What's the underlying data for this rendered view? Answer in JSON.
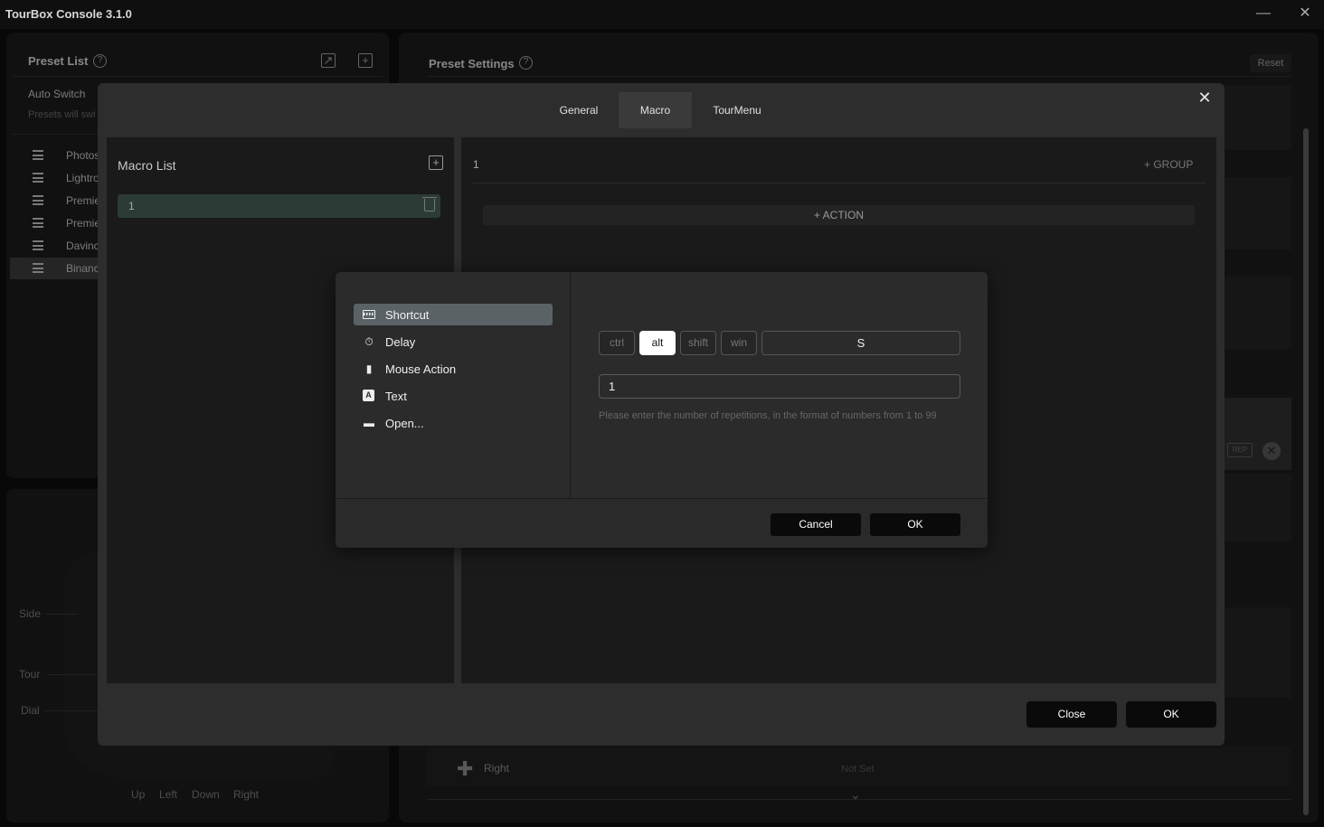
{
  "app": {
    "title": "TourBox Console 3.1.0"
  },
  "preset_list": {
    "title": "Preset List",
    "auto_switch": "Auto Switch",
    "auto_switch_desc": "Presets will swi",
    "items": [
      "Photos",
      "Lightro",
      "Premie",
      "Premie",
      "Davinc",
      "Binanc"
    ]
  },
  "device": {
    "labels": {
      "side": "Side",
      "tour": "Tour",
      "dial": "Dial",
      "up": "Up",
      "left": "Left",
      "down": "Down",
      "right": "Right"
    }
  },
  "preset_settings": {
    "title": "Preset Settings",
    "reset": "Reset",
    "rep_badge": "REP",
    "bottom_row_label": "Right",
    "bottom_row_value": "Not Set"
  },
  "macro_dialog": {
    "tabs": [
      "General",
      "Macro",
      "TourMenu"
    ],
    "active_tab": "Macro",
    "macro_list_title": "Macro List",
    "macros": [
      "1"
    ],
    "edit_name": "1",
    "group_label": "+ GROUP",
    "action_label": "+ ACTION",
    "close_label": "Close",
    "ok_label": "OK"
  },
  "action_dialog": {
    "types": [
      {
        "label": "Shortcut",
        "icon": "keyboard-icon"
      },
      {
        "label": "Delay",
        "icon": "stopwatch-icon"
      },
      {
        "label": "Mouse Action",
        "icon": "mouse-icon"
      },
      {
        "label": "Text",
        "icon": "text-icon"
      },
      {
        "label": "Open...",
        "icon": "folder-icon"
      }
    ],
    "selected": "Shortcut",
    "modifiers": [
      {
        "label": "ctrl",
        "on": false
      },
      {
        "label": "alt",
        "on": true
      },
      {
        "label": "shift",
        "on": false
      },
      {
        "label": "win",
        "on": false
      }
    ],
    "key": "S",
    "repetitions": "1",
    "hint": "Please enter the number of repetitions, in the format of numbers from 1 to 99",
    "cancel_label": "Cancel",
    "ok_label": "OK"
  },
  "colors": {
    "accent_selected": "#5a6266",
    "macro_item_bg": "#2c3b36",
    "button_bg": "#0a0a0a"
  }
}
